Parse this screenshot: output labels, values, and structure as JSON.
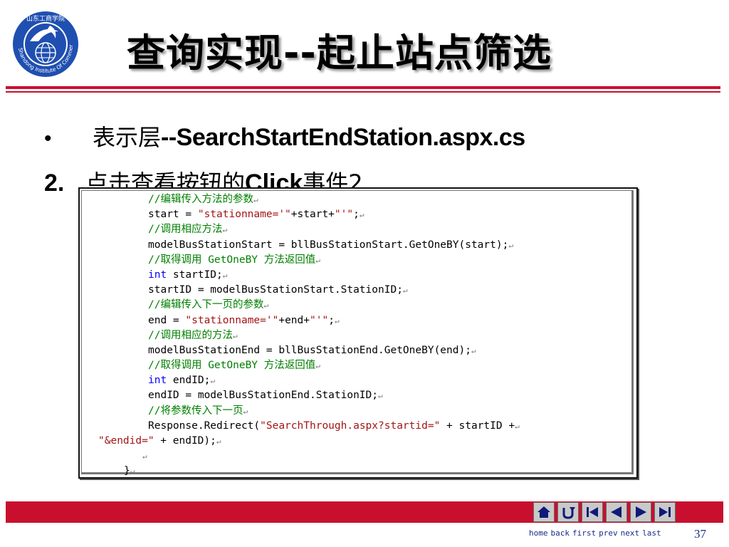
{
  "logo": {
    "top_text": "山东工商学院",
    "ring_text": "Shandong Institute Of Commerce"
  },
  "slide": {
    "title": "查询实现--起止站点筛选",
    "bullet": {
      "marker": "•",
      "cn": "表示层",
      "en": "--SearchStartEndStation.aspx.cs"
    },
    "step": {
      "number": "2.",
      "cn1": "点击查看按钮的",
      "en": "Click",
      "cn2": "事件2"
    }
  },
  "code": {
    "lines": [
      {
        "indent": "",
        "parts": [
          {
            "t": "//编辑传入方法的参数",
            "c": "c"
          }
        ]
      },
      {
        "indent": "",
        "parts": [
          {
            "t": "start = ",
            "c": ""
          },
          {
            "t": "\"stationname='\"",
            "c": "s"
          },
          {
            "t": "+start+",
            "c": ""
          },
          {
            "t": "\"'\"",
            "c": "s"
          },
          {
            "t": ";",
            "c": ""
          }
        ]
      },
      {
        "indent": "",
        "parts": [
          {
            "t": "//调用相应方法",
            "c": "c"
          }
        ]
      },
      {
        "indent": "",
        "parts": [
          {
            "t": "modelBusStationStart = bllBusStationStart.GetOneBY(start);",
            "c": ""
          }
        ]
      },
      {
        "indent": "",
        "parts": [
          {
            "t": "//取得调用 GetOneBY 方法返回值",
            "c": "c"
          }
        ]
      },
      {
        "indent": "",
        "parts": [
          {
            "t": "int",
            "c": "k"
          },
          {
            "t": " startID;",
            "c": ""
          }
        ]
      },
      {
        "indent": "",
        "parts": [
          {
            "t": "startID = modelBusStationStart.StationID;",
            "c": ""
          }
        ]
      },
      {
        "indent": "",
        "parts": [
          {
            "t": "//编辑传入下一页的参数",
            "c": "c"
          }
        ]
      },
      {
        "indent": "",
        "parts": [
          {
            "t": "end = ",
            "c": ""
          },
          {
            "t": "\"stationname='\"",
            "c": "s"
          },
          {
            "t": "+end+",
            "c": ""
          },
          {
            "t": "\"'\"",
            "c": "s"
          },
          {
            "t": ";",
            "c": ""
          }
        ]
      },
      {
        "indent": "",
        "parts": [
          {
            "t": "//调用相应的方法",
            "c": "c"
          }
        ]
      },
      {
        "indent": "",
        "parts": [
          {
            "t": "modelBusStationEnd = bllBusStationEnd.GetOneBY(end);",
            "c": ""
          }
        ]
      },
      {
        "indent": "",
        "parts": [
          {
            "t": "//取得调用 GetOneBY 方法返回值",
            "c": "c"
          }
        ]
      },
      {
        "indent": "",
        "parts": [
          {
            "t": "int",
            "c": "k"
          },
          {
            "t": " endID;",
            "c": ""
          }
        ]
      },
      {
        "indent": "",
        "parts": [
          {
            "t": "endID = modelBusStationEnd.StationID;",
            "c": ""
          }
        ]
      },
      {
        "indent": "",
        "parts": [
          {
            "t": "//将参数传入下一页",
            "c": "c"
          }
        ]
      },
      {
        "indent": "",
        "parts": [
          {
            "t": "Response.Redirect(",
            "c": ""
          },
          {
            "t": "\"SearchThrough.aspx?startid=\"",
            "c": "s"
          },
          {
            "t": " + startID +",
            "c": ""
          }
        ]
      },
      {
        "indent": "out",
        "parts": [
          {
            "t": "\"&endid=\"",
            "c": "s"
          },
          {
            "t": " + endID);",
            "c": ""
          }
        ]
      },
      {
        "indent": "blank",
        "parts": []
      },
      {
        "indent": "brace",
        "parts": [
          {
            "t": "}",
            "c": ""
          }
        ]
      }
    ],
    "return_mark": "↵"
  },
  "footer": {
    "nav_labels": [
      "home",
      "back",
      "first",
      "prev",
      "next",
      "last"
    ],
    "page_number": "37",
    "colors": {
      "bar": "#c8102e",
      "nav_text": "#1a2a8a",
      "nav_icon": "#0e1a7a"
    }
  }
}
